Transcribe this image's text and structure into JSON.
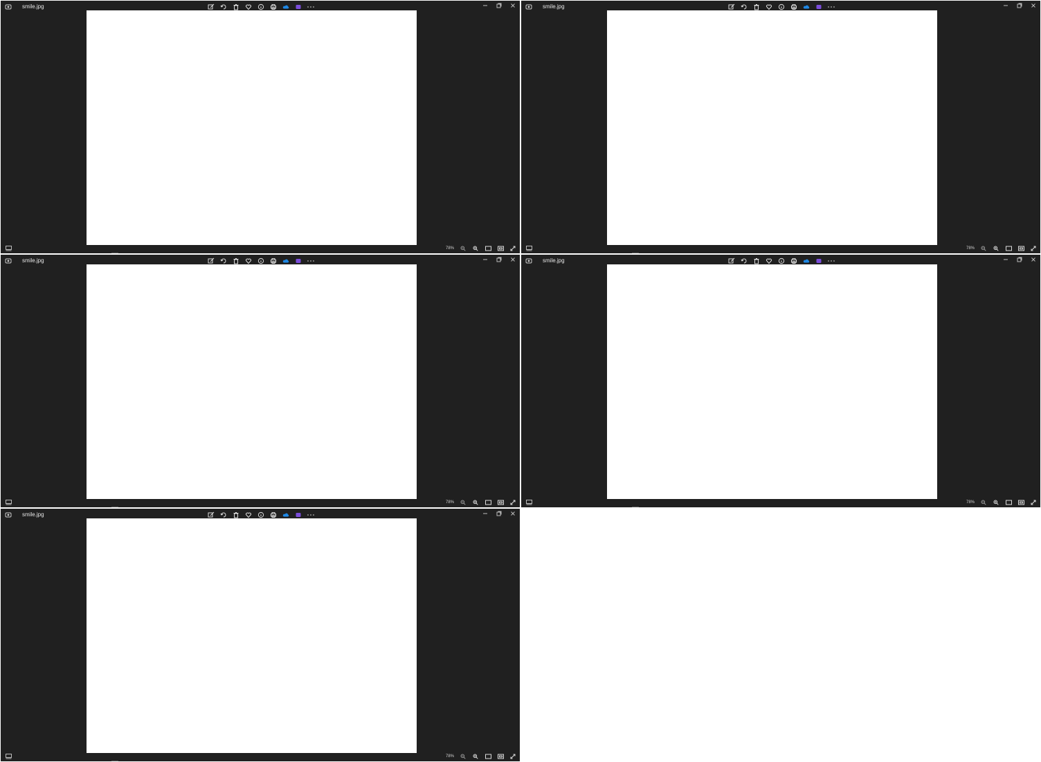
{
  "windows": [
    {
      "file_name": "smile.jpg",
      "zoom": "78%",
      "toolbar_icons": [
        "edit-icon",
        "rotate-icon",
        "delete-icon",
        "favorite-icon",
        "info-icon",
        "print-icon",
        "onedrive-icon",
        "clipchamp-icon",
        "more-icon"
      ],
      "window_controls": [
        "minimize-icon",
        "restore-icon",
        "close-icon"
      ],
      "status_icons": [
        "filmstrip-icon",
        "zoom-out-icon",
        "zoom-in-icon",
        "actual-size-icon",
        "fit-window-icon",
        "fullscreen-icon"
      ]
    },
    {
      "file_name": "smile.jpg",
      "zoom": "78%"
    },
    {
      "file_name": "smile.jpg",
      "zoom": "78%"
    },
    {
      "file_name": "smile.jpg",
      "zoom": "78%"
    },
    {
      "file_name": "smile.jpg",
      "zoom": "78%"
    }
  ],
  "colors": {
    "window_bg": "#202020",
    "image_bg": "#ffffff",
    "onedrive": "#1e88e5",
    "clipchamp": "#7b4ddb"
  }
}
